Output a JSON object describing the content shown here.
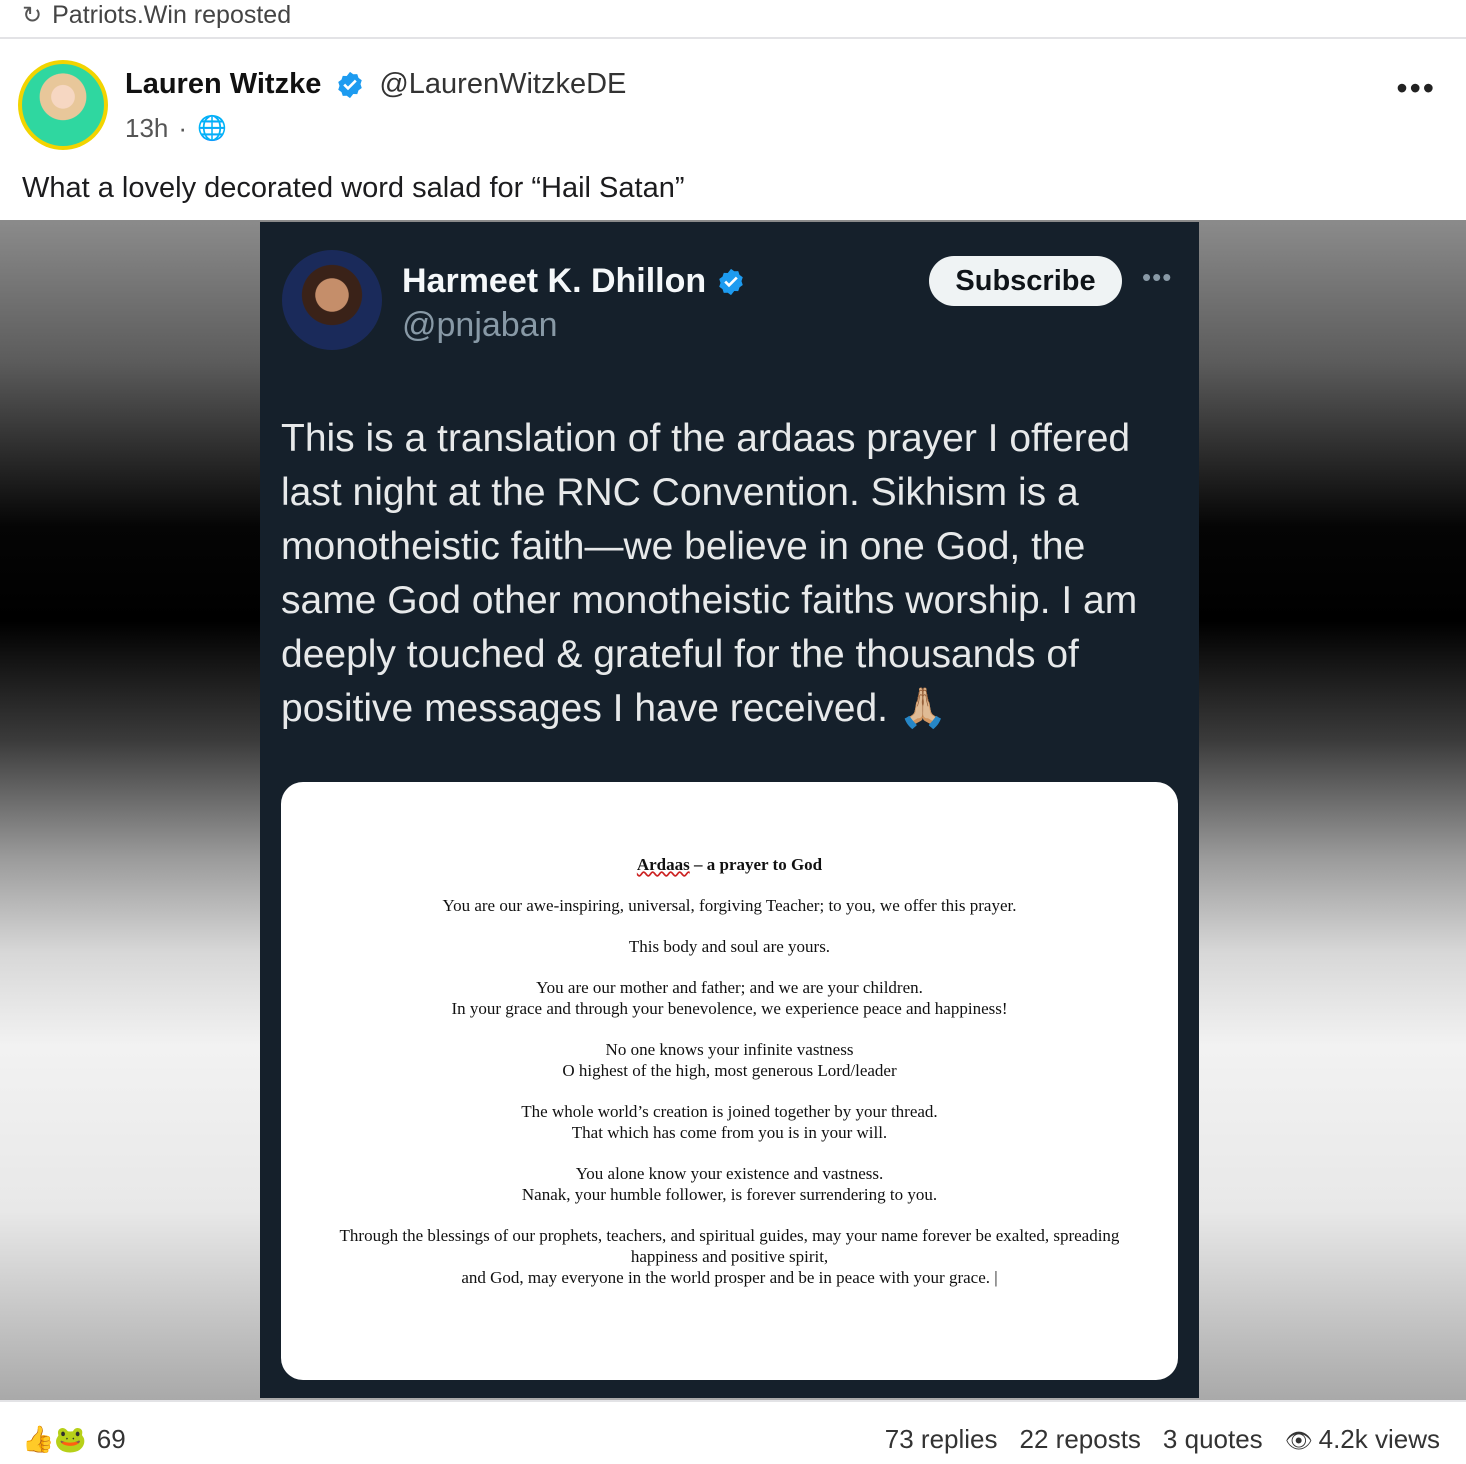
{
  "repost": {
    "icon": "repost-icon",
    "text": "Patriots.Win reposted"
  },
  "post": {
    "author_name": "Lauren Witzke",
    "author_handle": "@LaurenWitzkeDE",
    "time": "13h",
    "separator": "·",
    "more": "•••",
    "text": "What a lovely decorated word salad for “Hail Satan”"
  },
  "embedded_tweet": {
    "name": "Harmeet K. Dhillon",
    "handle": "@pnjaban",
    "subscribe_label": "Subscribe",
    "more": "•••",
    "body": "This is a translation of the ardaas prayer I offered last night at the RNC Convention. Sikhism is a monotheistic faith—we believe in one God, the same God other monotheistic faiths worship. I am deeply touched & grateful for the thousands of positive messages I have received. 🙏🏼",
    "document": {
      "title_underlined": "Ardaas",
      "title_rest": " – a prayer to God",
      "paragraphs": [
        [
          "You are our awe-inspiring, universal, forgiving Teacher; to you, we offer this prayer."
        ],
        [
          "This body and soul are yours."
        ],
        [
          "You are our mother and father; and we are your children.",
          "In your grace and through your benevolence, we experience peace and happiness!"
        ],
        [
          "No one knows your infinite vastness",
          "O highest of the high, most generous Lord/leader"
        ],
        [
          "The whole world’s creation is joined together by your thread.",
          "That which has come from you is in your will."
        ],
        [
          "You alone know your existence and vastness.",
          "Nanak, your humble follower, is forever surrendering to you."
        ],
        [
          "Through the blessings of our prophets, teachers, and spiritual guides, may your name forever be exalted, spreading",
          "happiness and positive spirit,",
          "and God, may everyone in the world prosper and be in peace with your grace. |"
        ]
      ]
    }
  },
  "footer": {
    "reaction_icons": "👍🐸",
    "reaction_count": "69",
    "replies": "73 replies",
    "reposts": "22 reposts",
    "quotes": "3 quotes",
    "views": "4.2k views"
  },
  "colors": {
    "verified": "#1d9bf0",
    "tweet_bg": "#15202b",
    "avatar_ring": "#f2d400"
  }
}
